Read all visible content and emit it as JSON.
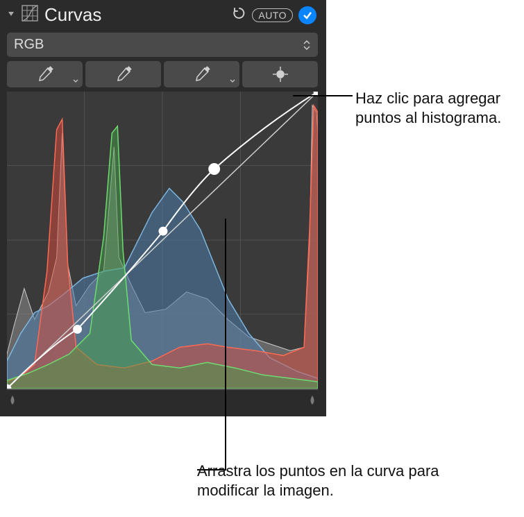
{
  "panel": {
    "title": "Curvas",
    "auto_label": "AUTO",
    "channel_selected": "RGB",
    "enabled": true,
    "tools": {
      "black_point": "eyedropper-black",
      "gray_point": "eyedropper-gray",
      "white_point": "eyedropper-white",
      "add_point": "add-point-crosshair"
    },
    "sliders": {
      "black": 0,
      "white": 100
    }
  },
  "callouts": {
    "add_point": "Haz clic para agregar puntos al histograma.",
    "drag_point": "Arrastra los puntos en la curva para modificar la imagen."
  },
  "chart_data": {
    "type": "area",
    "title": "",
    "xlabel": "",
    "ylabel": "",
    "xlim": [
      0,
      255
    ],
    "ylim": [
      0,
      100
    ],
    "legend": false,
    "series": [
      {
        "name": "red",
        "color": "#d94a3a"
      },
      {
        "name": "green",
        "color": "#46a048"
      },
      {
        "name": "blue",
        "color": "#4b7ca8"
      },
      {
        "name": "luminance",
        "color": "#a8a8a8"
      }
    ],
    "curve_points": [
      {
        "x": 0,
        "y": 0
      },
      {
        "x": 58,
        "y": 20
      },
      {
        "x": 128,
        "y": 53
      },
      {
        "x": 170,
        "y": 74
      },
      {
        "x": 255,
        "y": 100
      }
    ],
    "diagonal": [
      {
        "x": 0,
        "y": 0
      },
      {
        "x": 255,
        "y": 100
      }
    ]
  }
}
